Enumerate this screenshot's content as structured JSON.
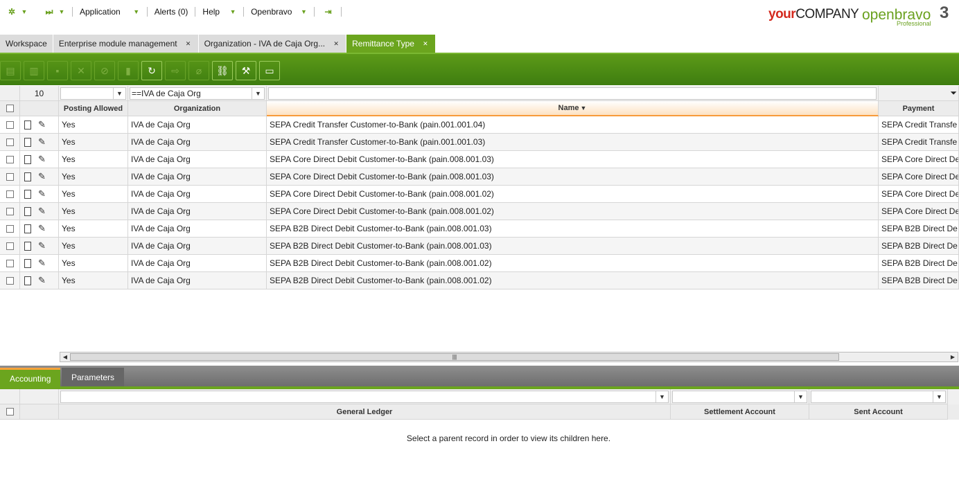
{
  "nav": {
    "application": "Application",
    "alerts": "Alerts (0)",
    "help": "Help",
    "user": "Openbravo"
  },
  "logos": {
    "company_your": "your",
    "company_rest": "COMPANY",
    "openbravo": "openbravo",
    "version": "3",
    "edition": "Professional"
  },
  "tabs": [
    {
      "label": "Workspace"
    },
    {
      "label": "Enterprise module management"
    },
    {
      "label": "Organization - IVA de Caja Org..."
    },
    {
      "label": "Remittance Type"
    }
  ],
  "grid": {
    "record_count": "10",
    "filter_org": "==IVA de Caja Org",
    "headers": {
      "posting": "Posting Allowed",
      "organization": "Organization",
      "name": "Name",
      "sort_indicator": "▼",
      "payment": "Payment"
    },
    "rows": [
      {
        "posting": "Yes",
        "org": "IVA de Caja Org",
        "name": "SEPA Credit Transfer Customer-to-Bank (pain.001.001.04)",
        "payment": "SEPA Credit Transfe"
      },
      {
        "posting": "Yes",
        "org": "IVA de Caja Org",
        "name": "SEPA Credit Transfer Customer-to-Bank (pain.001.001.03)",
        "payment": "SEPA Credit Transfe"
      },
      {
        "posting": "Yes",
        "org": "IVA de Caja Org",
        "name": "SEPA Core Direct Debit Customer-to-Bank (pain.008.001.03)",
        "payment": "SEPA Core Direct De"
      },
      {
        "posting": "Yes",
        "org": "IVA de Caja Org",
        "name": "SEPA Core Direct Debit Customer-to-Bank (pain.008.001.03)",
        "payment": "SEPA Core Direct De"
      },
      {
        "posting": "Yes",
        "org": "IVA de Caja Org",
        "name": "SEPA Core Direct Debit Customer-to-Bank (pain.008.001.02)",
        "payment": "SEPA Core Direct De"
      },
      {
        "posting": "Yes",
        "org": "IVA de Caja Org",
        "name": "SEPA Core Direct Debit Customer-to-Bank (pain.008.001.02)",
        "payment": "SEPA Core Direct De"
      },
      {
        "posting": "Yes",
        "org": "IVA de Caja Org",
        "name": "SEPA B2B Direct Debit Customer-to-Bank (pain.008.001.03)",
        "payment": "SEPA B2B Direct De"
      },
      {
        "posting": "Yes",
        "org": "IVA de Caja Org",
        "name": "SEPA B2B Direct Debit Customer-to-Bank (pain.008.001.03)",
        "payment": "SEPA B2B Direct De"
      },
      {
        "posting": "Yes",
        "org": "IVA de Caja Org",
        "name": "SEPA B2B Direct Debit Customer-to-Bank (pain.008.001.02)",
        "payment": "SEPA B2B Direct De"
      },
      {
        "posting": "Yes",
        "org": "IVA de Caja Org",
        "name": "SEPA B2B Direct Debit Customer-to-Bank (pain.008.001.02)",
        "payment": "SEPA B2B Direct De"
      }
    ]
  },
  "subtabs": {
    "accounting": "Accounting",
    "parameters": "Parameters"
  },
  "subgrid": {
    "headers": {
      "general_ledger": "General Ledger",
      "settlement": "Settlement Account",
      "sent": "Sent Account"
    },
    "empty_message": "Select a parent record in order to view its children here."
  },
  "colors": {
    "brand_green": "#6ba51e",
    "sort_orange": "#f79a3a"
  }
}
